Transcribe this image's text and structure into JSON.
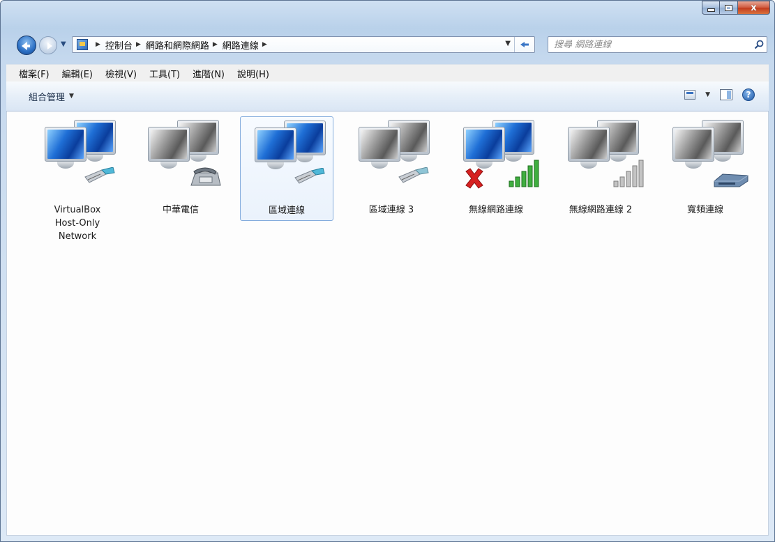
{
  "window": {
    "buttons": {
      "minimize": "minimize",
      "maximize": "maximize",
      "close": "x"
    }
  },
  "address_bar": {
    "breadcrumbs": [
      "控制台",
      "網路和網際網路",
      "網路連線"
    ],
    "search_placeholder": "搜尋 網路連線"
  },
  "menu": [
    "檔案(F)",
    "編輯(E)",
    "檢視(V)",
    "工具(T)",
    "進階(N)",
    "說明(H)"
  ],
  "command_bar": {
    "organize_label": "組合管理"
  },
  "connections": [
    {
      "label": "VirtualBox\nHost-Only\nNetwork",
      "icon": "ethernet-connection-icon",
      "state": "enabled"
    },
    {
      "label": "中華電信",
      "icon": "dialup-connection-icon",
      "state": "disabled"
    },
    {
      "label": "區域連線",
      "icon": "ethernet-connection-icon",
      "state": "enabled",
      "selected": true
    },
    {
      "label": "區域連線 3",
      "icon": "ethernet-connection-icon",
      "state": "disabled"
    },
    {
      "label": "無線網路連線",
      "icon": "wireless-connection-icon",
      "state": "not-connected"
    },
    {
      "label": "無線網路連線 2",
      "icon": "wireless-connection-icon",
      "state": "disabled"
    },
    {
      "label": "寬頻連線",
      "icon": "broadband-connection-icon",
      "state": "disabled"
    }
  ]
}
